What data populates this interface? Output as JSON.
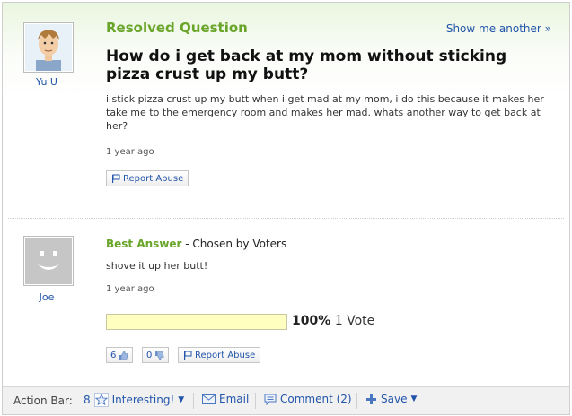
{
  "question": {
    "header": "Resolved Question",
    "show_another": "Show me another »",
    "title": "How do i get back at my mom without sticking pizza crust up my butt?",
    "body": "i stick pizza crust up my butt when i get mad at my mom, i do this because it makes her take me to the emergency room and makes her mad. whats another way to get back at her?",
    "age": "1 year ago",
    "report_label": "Report Abuse",
    "asker": "Yu U"
  },
  "answer": {
    "best_label": "Best Answer",
    "chosen_by": " - Chosen by Voters",
    "text": "shove it up her butt!",
    "age": "1 year ago",
    "answerer": "Joe",
    "vote_percent": "100%",
    "vote_count": "1 Vote",
    "vote_fraction": 1.0,
    "thumbs_up": "6",
    "thumbs_down": "0",
    "report_label": "Report Abuse"
  },
  "action_bar": {
    "label": "Action Bar:",
    "interesting_count": "8",
    "interesting_label": "Interesting!",
    "email_label": "Email",
    "comment_label": "Comment (2)",
    "save_label": "Save"
  },
  "colors": {
    "accent_green": "#69a52a",
    "link_blue": "#2255aa",
    "vote_bar": "#ffffbf"
  }
}
